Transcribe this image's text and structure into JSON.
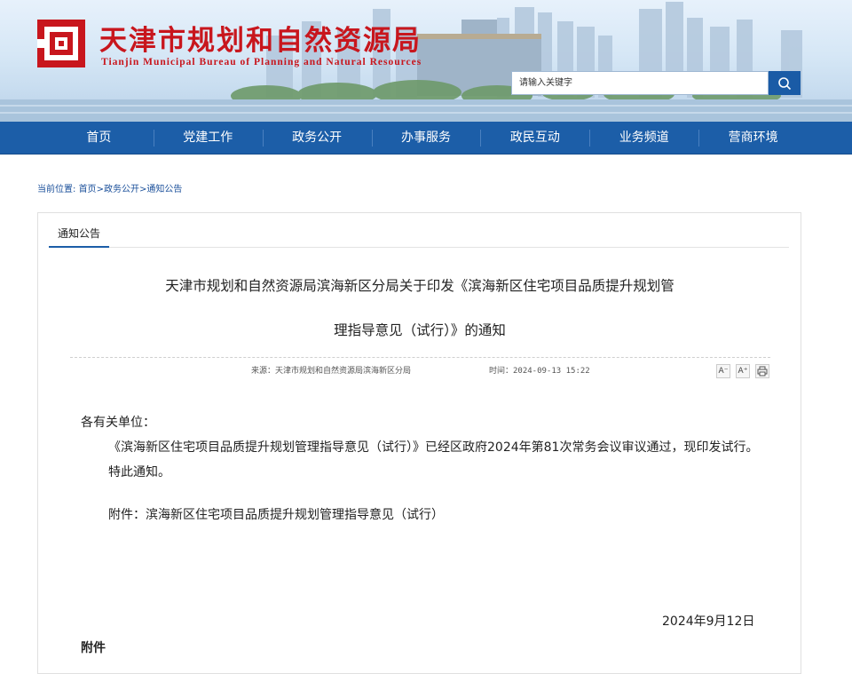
{
  "header": {
    "title": "天津市规划和自然资源局",
    "subtitle": "Tianjin Municipal Bureau of Planning and Natural Resources",
    "search_placeholder": "请输入关键字"
  },
  "colors": {
    "brand_red": "#c8161d",
    "nav_blue": "#1c5ea8",
    "link_blue": "#1a4f9a"
  },
  "nav": {
    "items": [
      {
        "label": "首页"
      },
      {
        "label": "党建工作"
      },
      {
        "label": "政务公开"
      },
      {
        "label": "办事服务"
      },
      {
        "label": "政民互动"
      },
      {
        "label": "业务频道"
      },
      {
        "label": "营商环境"
      }
    ]
  },
  "breadcrumb": {
    "prefix": "当前位置:",
    "items": [
      "首页",
      "政务公开",
      "通知公告"
    ],
    "sep": ">"
  },
  "tab": {
    "label": "通知公告"
  },
  "article": {
    "title_line1": "天津市规划和自然资源局滨海新区分局关于印发《滨海新区住宅项目品质提升规划管",
    "title_line2": "理指导意见（试行）》的通知",
    "source": "来源：天津市规划和自然资源局滨海新区分局",
    "time": "时间：2024-09-13 15:22",
    "tools": {
      "font_smaller": "A⁻",
      "font_larger": "A⁺"
    },
    "salutation": "各有关单位：",
    "body": "《滨海新区住宅项目品质提升规划管理指导意见（试行）》已经区政府2024年第81次常务会议审议通过，现印发试行。",
    "notice": "特此通知。",
    "attachment_note": "附件：滨海新区住宅项目品质提升规划管理指导意见（试行）",
    "date": "2024年9月12日",
    "attachment_heading": "附件"
  }
}
